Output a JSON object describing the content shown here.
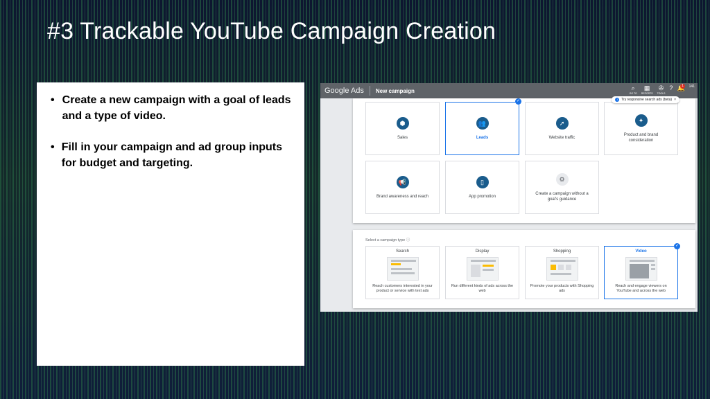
{
  "slide": {
    "title": "#3 Trackable YouTube Campaign Creation",
    "bullets": [
      "Create a new campaign with a goal of leads and a type of video.",
      "Fill in your campaign and ad group inputs for budget and targeting."
    ],
    "bullet_symbol": "•"
  },
  "screenshot": {
    "app_name": "Google Ads",
    "page_name": "New campaign",
    "top_icons": [
      {
        "icon": "search-icon",
        "label": "GO TO"
      },
      {
        "icon": "reports-icon",
        "label": "REPORTS"
      },
      {
        "icon": "wrench-icon",
        "label": "TOOLS"
      }
    ],
    "notification_count": "1",
    "account_text": "141",
    "tip": {
      "text": "Try responsive search ads (beta)",
      "close": "×"
    },
    "goals": [
      {
        "label": "Sales",
        "icon": "tag-icon",
        "selected": false
      },
      {
        "label": "Leads",
        "icon": "people-icon",
        "selected": true
      },
      {
        "label": "Website traffic",
        "icon": "cursor-click-icon",
        "selected": false
      },
      {
        "label": "Product and brand consideration",
        "icon": "sparkle-icon",
        "selected": false
      },
      {
        "label": "Brand awareness and reach",
        "icon": "megaphone-icon",
        "selected": false
      },
      {
        "label": "App promotion",
        "icon": "phone-icon",
        "selected": false
      },
      {
        "label": "Create a campaign without a goal's guidance",
        "icon": "gear-icon",
        "selected": false
      }
    ],
    "campaign_type_heading": "Select a campaign type",
    "campaign_types": [
      {
        "name": "Search",
        "description": "Reach customers interested in your product or service with text ads",
        "selected": false
      },
      {
        "name": "Display",
        "description": "Run different kinds of ads across the web",
        "selected": false
      },
      {
        "name": "Shopping",
        "description": "Promote your products with Shopping ads",
        "selected": false
      },
      {
        "name": "Video",
        "description": "Reach and engage viewers on YouTube and across the web",
        "selected": true
      }
    ],
    "colors": {
      "accent": "#1a73e8",
      "goal_icon": "#1a5c8c",
      "topbar": "#5f6368"
    }
  }
}
